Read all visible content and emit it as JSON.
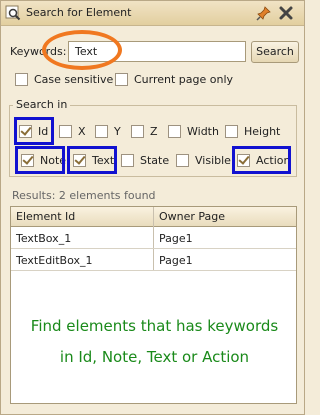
{
  "window": {
    "title": "Search for Element"
  },
  "search": {
    "keywords_label": "Keywords:",
    "value": "Text",
    "button_label": "Search",
    "case_sensitive_label": "Case sensitive",
    "case_sensitive_checked": false,
    "current_page_only_label": "Current page only",
    "current_page_only_checked": false
  },
  "search_in": {
    "legend": "Search in",
    "fields": [
      {
        "label": "Id",
        "checked": true
      },
      {
        "label": "X",
        "checked": false
      },
      {
        "label": "Y",
        "checked": false
      },
      {
        "label": "Z",
        "checked": false
      },
      {
        "label": "Width",
        "checked": false
      },
      {
        "label": "Height",
        "checked": false
      },
      {
        "label": "Note",
        "checked": true
      },
      {
        "label": "Text",
        "checked": true
      },
      {
        "label": "State",
        "checked": false
      },
      {
        "label": "Visible",
        "checked": false
      },
      {
        "label": "Action",
        "checked": true
      }
    ]
  },
  "results": {
    "summary": "Results: 2 elements found",
    "columns": [
      "Element Id",
      "Owner Page"
    ],
    "rows": [
      {
        "element_id": "TextBox_1",
        "owner_page": "Page1"
      },
      {
        "element_id": "TextEditBox_1",
        "owner_page": "Page1"
      }
    ]
  },
  "annotation": {
    "line1": "Find elements that has keywords",
    "line2": "in Id, Note, Text or Action",
    "color": "#1a8a1a"
  },
  "colors": {
    "highlight_box": "#1111d0",
    "highlight_ellipse": "#f07820",
    "titlebar": "#e9d8ad"
  }
}
